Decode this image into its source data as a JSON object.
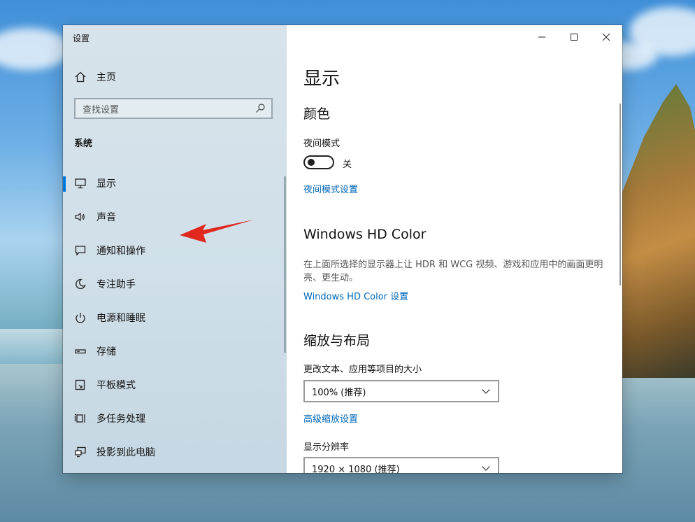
{
  "app": {
    "title": "设置"
  },
  "sidebar": {
    "home_label": "主页",
    "search_placeholder": "查找设置",
    "section_label": "系统",
    "items": [
      {
        "label": "显示",
        "icon": "monitor-icon",
        "active": true
      },
      {
        "label": "声音",
        "icon": "speaker-icon"
      },
      {
        "label": "通知和操作",
        "icon": "notification-icon"
      },
      {
        "label": "专注助手",
        "icon": "moon-icon"
      },
      {
        "label": "电源和睡眠",
        "icon": "power-icon"
      },
      {
        "label": "存储",
        "icon": "storage-icon"
      },
      {
        "label": "平板模式",
        "icon": "tablet-mode-icon"
      },
      {
        "label": "多任务处理",
        "icon": "multitasking-icon"
      },
      {
        "label": "投影到此电脑",
        "icon": "project-icon"
      }
    ]
  },
  "content": {
    "page_title": "显示",
    "color": {
      "heading": "颜色",
      "night_mode_label": "夜间模式",
      "toggle_state": "关",
      "night_mode_link": "夜间模式设置"
    },
    "hdr": {
      "heading": "Windows HD Color",
      "description": "在上面所选择的显示器上让 HDR 和 WCG 视频、游戏和应用中的画面更明亮、更生动。",
      "link": "Windows HD Color 设置"
    },
    "scale": {
      "heading": "缩放与布局",
      "size_label": "更改文本、应用等项目的大小",
      "size_value": "100% (推荐)",
      "advanced_link": "高级缩放设置",
      "resolution_label": "显示分辨率",
      "resolution_value": "1920 × 1080 (推荐)"
    }
  },
  "colors": {
    "accent": "#0078d7",
    "link": "#0067b8",
    "annotation_arrow": "#e0281e"
  }
}
